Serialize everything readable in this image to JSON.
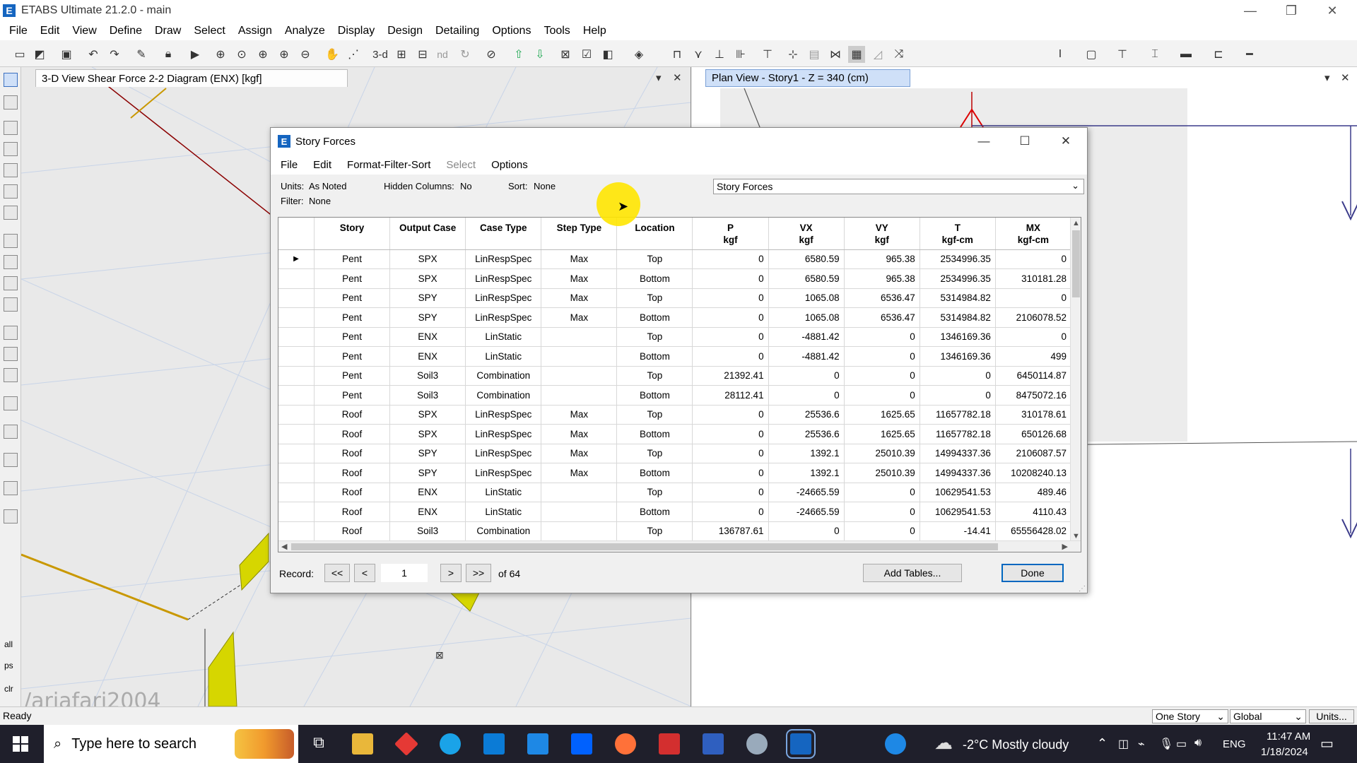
{
  "window": {
    "title": "ETABS Ultimate 21.2.0 - main",
    "app_icon": "E",
    "controls": [
      "—",
      "❐",
      "✕"
    ]
  },
  "menu": [
    "File",
    "Edit",
    "View",
    "Define",
    "Draw",
    "Select",
    "Assign",
    "Analyze",
    "Display",
    "Design",
    "Detailing",
    "Options",
    "Tools",
    "Help"
  ],
  "toolbar": {
    "threed_label": "3-d",
    "nd_label": "nd"
  },
  "left_tools": {
    "labels": [
      "all",
      "ps",
      "clr"
    ]
  },
  "left_pane": {
    "tab_label": "3-D View   Shear Force 2-2 Diagram   (ENX)  [kgf]",
    "controls": [
      "▾",
      "✕"
    ],
    "watermark": "/arjafari2004"
  },
  "right_pane": {
    "tab_label": "Plan View - Story1 - Z = 340 (cm)",
    "controls": [
      "▾",
      "✕"
    ]
  },
  "dialog": {
    "title": "Story Forces",
    "icon": "E",
    "controls": [
      "—",
      "☐",
      "✕"
    ],
    "menu": [
      {
        "label": "File",
        "enabled": true
      },
      {
        "label": "Edit",
        "enabled": true
      },
      {
        "label": "Format-Filter-Sort",
        "enabled": true
      },
      {
        "label": "Select",
        "enabled": false
      },
      {
        "label": "Options",
        "enabled": true
      }
    ],
    "info": {
      "units_label": "Units:",
      "units_value": "As Noted",
      "hidden_label": "Hidden Columns:",
      "hidden_value": "No",
      "sort_label": "Sort:",
      "sort_value": "None",
      "filter_label": "Filter:",
      "filter_value": "None"
    },
    "dataset": "Story Forces",
    "columns": [
      "Story",
      "Output Case",
      "Case Type",
      "Step Type",
      "Location",
      "P\nkgf",
      "VX\nkgf",
      "VY\nkgf",
      "T\nkgf-cm",
      "MX\nkgf-cm"
    ],
    "rows": [
      [
        "Pent",
        "SPX",
        "LinRespSpec",
        "Max",
        "Top",
        "0",
        "6580.59",
        "965.38",
        "2534996.35",
        "0"
      ],
      [
        "Pent",
        "SPX",
        "LinRespSpec",
        "Max",
        "Bottom",
        "0",
        "6580.59",
        "965.38",
        "2534996.35",
        "310181.28"
      ],
      [
        "Pent",
        "SPY",
        "LinRespSpec",
        "Max",
        "Top",
        "0",
        "1065.08",
        "6536.47",
        "5314984.82",
        "0"
      ],
      [
        "Pent",
        "SPY",
        "LinRespSpec",
        "Max",
        "Bottom",
        "0",
        "1065.08",
        "6536.47",
        "5314984.82",
        "2106078.52"
      ],
      [
        "Pent",
        "ENX",
        "LinStatic",
        "",
        "Top",
        "0",
        "-4881.42",
        "0",
        "1346169.36",
        "0"
      ],
      [
        "Pent",
        "ENX",
        "LinStatic",
        "",
        "Bottom",
        "0",
        "-4881.42",
        "0",
        "1346169.36",
        "499"
      ],
      [
        "Pent",
        "Soil3",
        "Combination",
        "",
        "Top",
        "21392.41",
        "0",
        "0",
        "0",
        "6450114.87"
      ],
      [
        "Pent",
        "Soil3",
        "Combination",
        "",
        "Bottom",
        "28112.41",
        "0",
        "0",
        "0",
        "8475072.16"
      ],
      [
        "Roof",
        "SPX",
        "LinRespSpec",
        "Max",
        "Top",
        "0",
        "25536.6",
        "1625.65",
        "11657782.18",
        "310178.61"
      ],
      [
        "Roof",
        "SPX",
        "LinRespSpec",
        "Max",
        "Bottom",
        "0",
        "25536.6",
        "1625.65",
        "11657782.18",
        "650126.68"
      ],
      [
        "Roof",
        "SPY",
        "LinRespSpec",
        "Max",
        "Top",
        "0",
        "1392.1",
        "25010.39",
        "14994337.36",
        "2106087.57"
      ],
      [
        "Roof",
        "SPY",
        "LinRespSpec",
        "Max",
        "Bottom",
        "0",
        "1392.1",
        "25010.39",
        "14994337.36",
        "10208240.13"
      ],
      [
        "Roof",
        "ENX",
        "LinStatic",
        "",
        "Top",
        "0",
        "-24665.59",
        "0",
        "10629541.53",
        "489.46"
      ],
      [
        "Roof",
        "ENX",
        "LinStatic",
        "",
        "Bottom",
        "0",
        "-24665.59",
        "0",
        "10629541.53",
        "4110.43"
      ],
      [
        "Roof",
        "Soil3",
        "Combination",
        "",
        "Top",
        "136787.61",
        "0",
        "0",
        "-14.41",
        "65556428.02"
      ]
    ],
    "current_row_marker": "▶",
    "record": {
      "label": "Record:",
      "first": "<<",
      "prev": "<",
      "value": "1",
      "next": ">",
      "last": ">>",
      "of_text": "of 64"
    },
    "add_tables_label": "Add Tables...",
    "done_label": "Done"
  },
  "statusbar": {
    "status_text": "Ready",
    "story_option": "One Story",
    "coord_option": "Global",
    "units_button": "Units..."
  },
  "taskbar": {
    "search_placeholder": "Type here to search",
    "weather": "-2°C  Mostly cloudy",
    "lang": "ENG",
    "time": "11:47 AM",
    "date": "1/18/2024"
  }
}
